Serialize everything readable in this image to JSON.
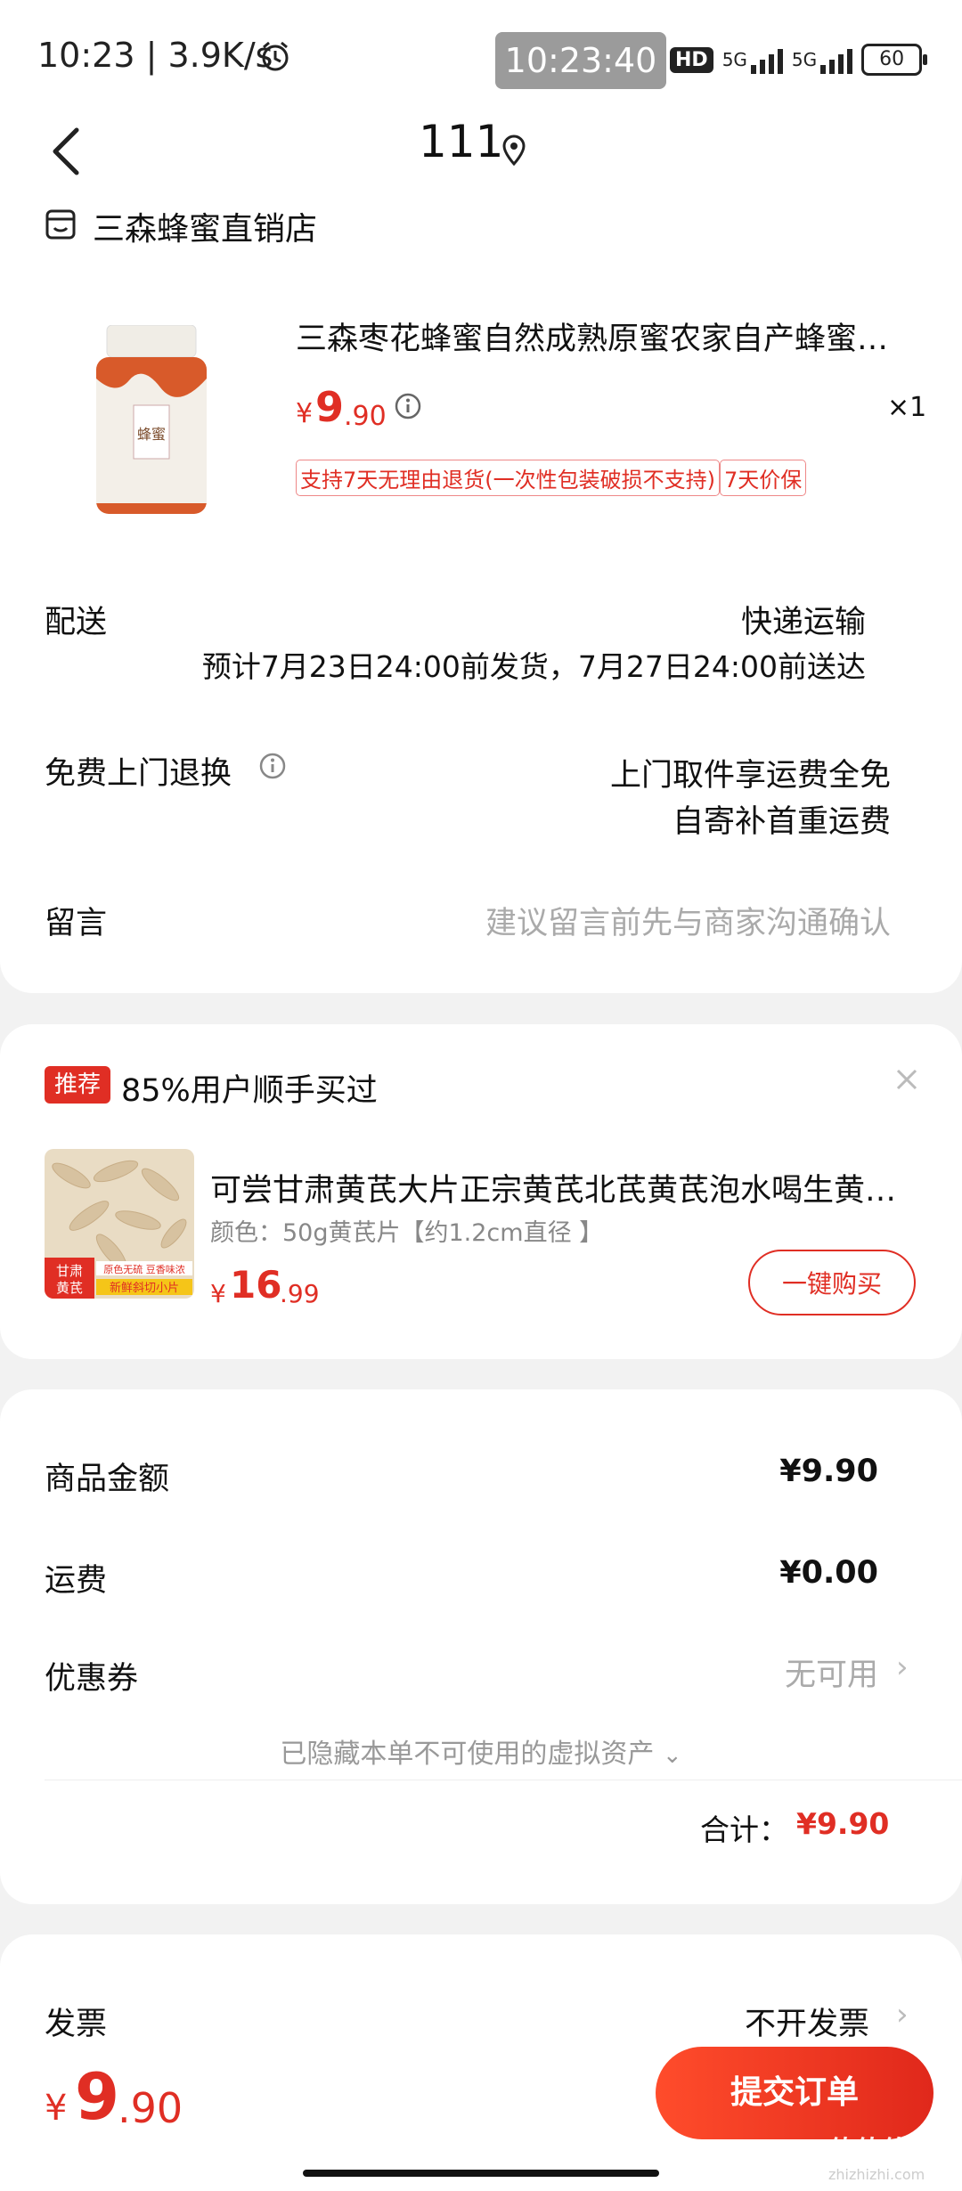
{
  "status_bar": {
    "time_speed": "10:23 | 3.9K/s",
    "clock": "10:23:40",
    "hd": "HD",
    "net1": "5G",
    "net2": "5G",
    "battery": "60"
  },
  "header": {
    "title": "111"
  },
  "shop": {
    "name": "三森蜂蜜直销店"
  },
  "product": {
    "title": "三森枣花蜂蜜自然成熟原蜜农家自产蜂蜜…",
    "price_symbol": "¥",
    "price_int": "9",
    "price_dec": ".90",
    "quantity": "×1",
    "tags": [
      "支持7天无理由退货(一次性包装破损不支持)",
      "7天价保"
    ],
    "image_label": "蜂蜜"
  },
  "delivery": {
    "label": "配送",
    "method": "快递运输",
    "estimate": "预计7月23日24:00前发货，7月27日24:00前送达"
  },
  "return_service": {
    "label": "免费上门退换",
    "line1": "上门取件享运费全免",
    "line2": "自寄补首重运费"
  },
  "message": {
    "label": "留言",
    "placeholder": "建议留言前先与商家沟通确认"
  },
  "recommendation": {
    "badge": "推荐",
    "title": "85%用户顺手买过",
    "name": "可尝甘肃黄芪大片正宗黄芪北芪黄芪泡水喝生黄…",
    "spec": "颜色：50g黄芪片【约1.2cm直径 】",
    "price_symbol": "¥",
    "price_int": "16",
    "price_dec": ".99",
    "buy_label": "一键购买",
    "image_tag1": "甘肃黄芪",
    "image_tag2": "原色无硫 豆香味浓",
    "image_tag3": "新鲜斜切小片"
  },
  "summary": {
    "goods_label": "商品金额",
    "goods_value": "¥9.90",
    "shipping_label": "运费",
    "shipping_value": "¥0.00",
    "coupon_label": "优惠券",
    "coupon_value": "无可用",
    "hidden_assets": "已隐藏本单不可使用的虚拟资产",
    "total_label": "合计：",
    "total_value": "¥9.90"
  },
  "invoice": {
    "label": "发票",
    "value": "不开发票"
  },
  "bottom": {
    "price_symbol": "¥",
    "price_int": "9",
    "price_dec": ".90",
    "submit_label": "提交订单"
  },
  "watermark": {
    "main": "值值值",
    "sub": "zhizhizhi.com"
  }
}
